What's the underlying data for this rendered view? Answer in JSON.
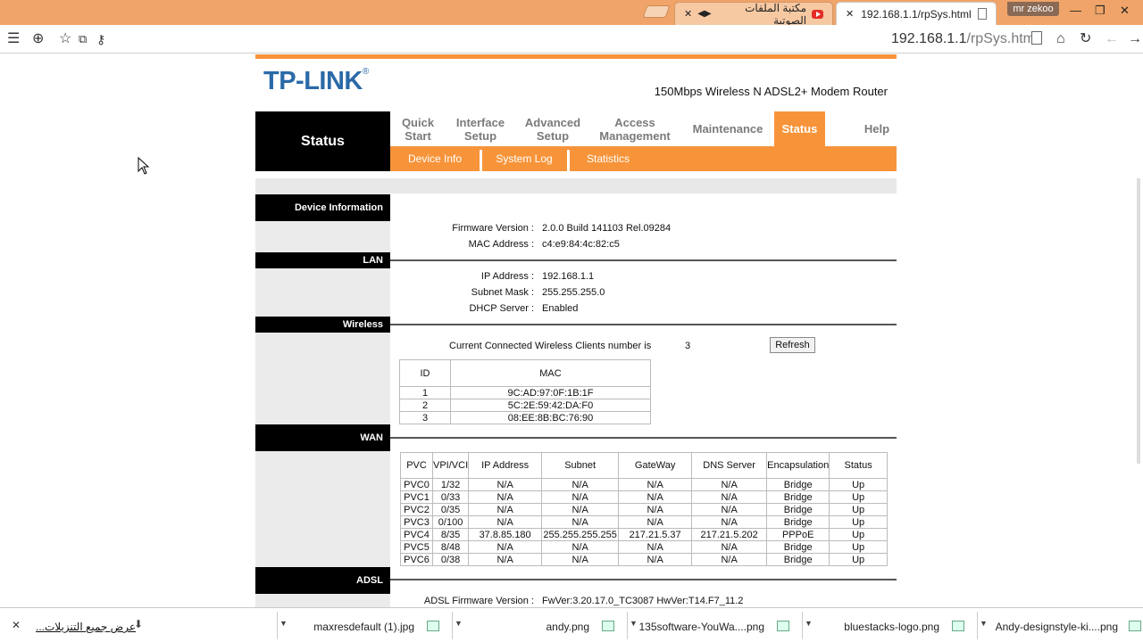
{
  "browser": {
    "tabs": [
      {
        "title": "مكتبة الملفات الصوتية",
        "active": false,
        "icon": "youtube-icon"
      },
      {
        "title": "192.168.1.1/rpSys.html",
        "active": true,
        "icon": "page-icon"
      }
    ],
    "user": "mr zekoo",
    "url_host": "192.168.1.1",
    "url_path": "/rpSys.html"
  },
  "router": {
    "brand": "TP-LINK",
    "registered": "®",
    "model": "150Mbps Wireless N ADSL2+ Modem Router",
    "section_title": "Status",
    "nav": [
      {
        "l1": "Quick",
        "l2": "Start"
      },
      {
        "l1": "Interface",
        "l2": "Setup"
      },
      {
        "l1": "Advanced",
        "l2": "Setup"
      },
      {
        "l1": "Access",
        "l2": "Management"
      },
      {
        "l1": "Maintenance",
        "l2": ""
      },
      {
        "l1": "Status",
        "l2": ""
      },
      {
        "l1": "Help",
        "l2": ""
      }
    ],
    "subnav": [
      "Device Info",
      "System Log",
      "Statistics"
    ],
    "sections": {
      "device": "Device Information",
      "lan": "LAN",
      "wireless": "Wireless",
      "wan": "WAN",
      "adsl": "ADSL"
    },
    "device_info": {
      "firmware_label": "Firmware Version :",
      "firmware_value": "2.0.0 Build 141103 Rel.09284",
      "mac_label": "MAC Address :",
      "mac_value": "c4:e9:84:4c:82:c5"
    },
    "lan": {
      "ip_label": "IP Address :",
      "ip_value": "192.168.1.1",
      "mask_label": "Subnet Mask :",
      "mask_value": "255.255.255.0",
      "dhcp_label": "DHCP Server :",
      "dhcp_value": "Enabled"
    },
    "wireless": {
      "clients_label": "Current Connected Wireless Clients number is",
      "clients_count": "3",
      "refresh_label": "Refresh",
      "headers": [
        "ID",
        "MAC"
      ],
      "rows": [
        [
          "1",
          "9C:AD:97:0F:1B:1F"
        ],
        [
          "2",
          "5C:2E:59:42:DA:F0"
        ],
        [
          "3",
          "08:EE:8B:BC:76:90"
        ]
      ]
    },
    "wan": {
      "headers": [
        "PVC",
        "VPI/VCI",
        "IP Address",
        "Subnet",
        "GateWay",
        "DNS Server",
        "Encapsulation",
        "Status"
      ],
      "rows": [
        [
          "PVC0",
          "1/32",
          "N/A",
          "N/A",
          "N/A",
          "N/A",
          "Bridge",
          "Up"
        ],
        [
          "PVC1",
          "0/33",
          "N/A",
          "N/A",
          "N/A",
          "N/A",
          "Bridge",
          "Up"
        ],
        [
          "PVC2",
          "0/35",
          "N/A",
          "N/A",
          "N/A",
          "N/A",
          "Bridge",
          "Up"
        ],
        [
          "PVC3",
          "0/100",
          "N/A",
          "N/A",
          "N/A",
          "N/A",
          "Bridge",
          "Up"
        ],
        [
          "PVC4",
          "8/35",
          "37.8.85.180",
          "255.255.255.255",
          "217.21.5.37",
          "217.21.5.202",
          "PPPoE",
          "Up"
        ],
        [
          "PVC5",
          "8/48",
          "N/A",
          "N/A",
          "N/A",
          "N/A",
          "Bridge",
          "Up"
        ],
        [
          "PVC6",
          "0/38",
          "N/A",
          "N/A",
          "N/A",
          "N/A",
          "Bridge",
          "Up"
        ]
      ]
    },
    "adsl": {
      "fw_label": "ADSL Firmware Version :",
      "fw_value": "FwVer:3.20.17.0_TC3087 HwVer:T14.F7_11.2"
    }
  },
  "downloads": {
    "show_all": "عرض جميع التنزيلات...",
    "items": [
      "maxresdefault (1).jpg",
      "andy.png",
      "135software-YouWa....png",
      "bluestacks-logo.png",
      "Andy-designstyle-ki....png"
    ]
  },
  "colors": {
    "accent": "#f7943a",
    "brand": "#2a6aa8",
    "titlebar": "#f0a469"
  }
}
